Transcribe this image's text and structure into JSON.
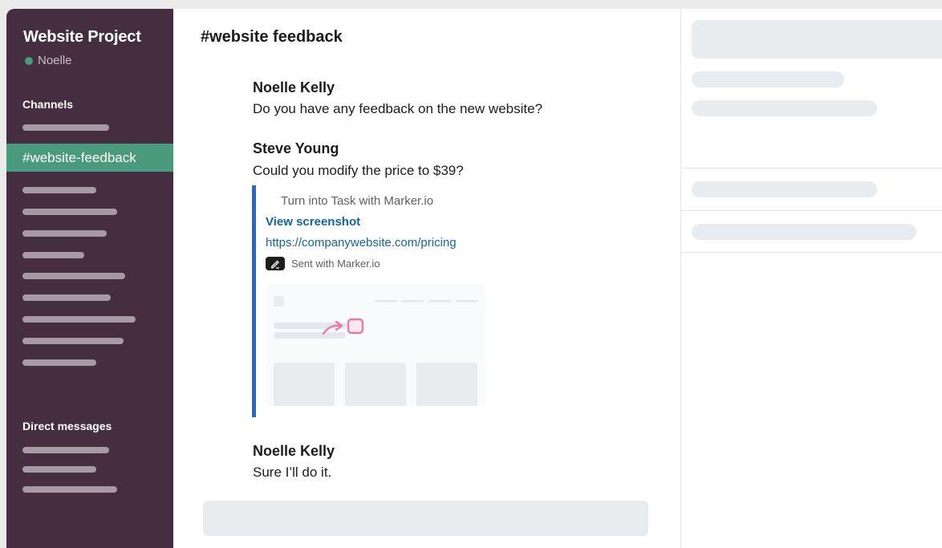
{
  "workspace": {
    "title": "Website Project",
    "user": "Noelle"
  },
  "sidebar": {
    "channels_label": "Channels",
    "active_channel": "#website-feedback",
    "dm_label": "Direct messages"
  },
  "channel": {
    "title": "#website feedback"
  },
  "messages": [
    {
      "author": "Noelle Kelly",
      "text": "Do you have any feedback on the new website?"
    },
    {
      "author": "Steve Young",
      "text": "Could you modify the price to $39?"
    },
    {
      "author": "Noelle Kelly",
      "text": "Sure I’ll do it."
    }
  ],
  "attachment": {
    "header": "Turn into Task with Marker.io",
    "link_label": "View screenshot",
    "url": "https://companywebsite.com/pricing",
    "sent_with": "Sent with Marker.io",
    "accent_color": "#2b66c1",
    "annotation_color": "#e879a8"
  },
  "colors": {
    "sidebar_bg": "#452e3f",
    "active_channel_bg": "#4a9a7e",
    "status_online": "#4a9a7e",
    "link": "#1264a3"
  },
  "icons": {
    "status": "online-dot",
    "marker": "marker-pen-icon",
    "annotation": "arrow-annotation-icon"
  }
}
